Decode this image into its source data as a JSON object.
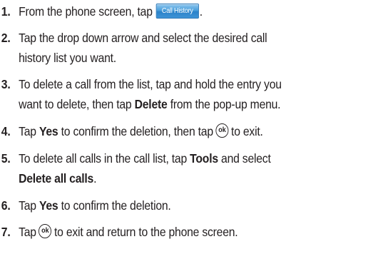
{
  "steps": [
    {
      "number": "1.",
      "text_before": "From the phone screen, tap",
      "button_label": "Call History",
      "text_after": "."
    },
    {
      "number": "2.",
      "line1": "Tap the drop down arrow and select the desired call",
      "line2": "history list you want."
    },
    {
      "number": "3.",
      "line1": "To delete a call from the list, tap and hold the entry you",
      "line2_before": "want to delete, then tap",
      "line2_bold": "Delete",
      "line2_after": "from the pop-up menu."
    },
    {
      "number": "4.",
      "text_a": "Tap",
      "bold_a": "Yes",
      "text_b": "to confirm the deletion, then tap",
      "icon_label": "ok",
      "text_c": "to exit."
    },
    {
      "number": "5.",
      "line1_before": "To delete all calls in the call list, tap",
      "line1_bold": "Tools",
      "line1_after": "and select",
      "line2_bold": "Delete all calls",
      "line2_after": "."
    },
    {
      "number": "6.",
      "text_a": "Tap",
      "bold_a": "Yes",
      "text_b": "to confirm the deletion."
    },
    {
      "number": "7.",
      "text_a": "Tap",
      "icon_label": "ok",
      "text_b": "to exit and return to the phone screen."
    }
  ],
  "colors": {
    "text": "#231f20",
    "button_gradient_top": "#8fc7ee",
    "button_gradient_bottom": "#2b82c9"
  }
}
